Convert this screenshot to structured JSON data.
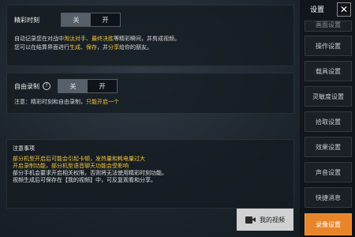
{
  "highlights": {
    "panel1_row1": [
      {
        "t": "自动记录您在对战中",
        "h": false
      },
      {
        "t": "淘汰对手、最终决胜",
        "h": true
      },
      {
        "t": "等精彩瞬间，并剪成视频。",
        "h": false
      }
    ],
    "panel1_row2": [
      {
        "t": "您可以在结算界面进行",
        "h": false
      },
      {
        "t": "生成、保存",
        "h": true
      },
      {
        "t": "，并",
        "h": false
      },
      {
        "t": "分享",
        "h": true
      },
      {
        "t": "给你的朋友。",
        "h": false
      }
    ],
    "panel2_note": [
      {
        "t": "注意：精彩时刻和自由录制，",
        "h": false
      },
      {
        "t": "只能开启一个",
        "h": true
      }
    ]
  },
  "highlights_section": {
    "label": "精彩时刻",
    "toggle_off": "关",
    "toggle_on": "开"
  },
  "free_record_section": {
    "label": "自由录制",
    "help": "?",
    "toggle_off": "关",
    "toggle_on": "开"
  },
  "notice": {
    "title": "注意事项",
    "lines": [
      {
        "text": "部分机型开启后可能会引起卡顿，发热量和耗电量过大",
        "color": "yellow"
      },
      {
        "text": "开启录制功能，部分机型语音聊天功能会受影响",
        "color": "yellow"
      },
      {
        "text": "部分手机会要求开启相关权限，否则将无法使用精彩时刻功能。",
        "color": "white"
      },
      {
        "text": "视频生成后可保存在【我的视频】中，可反复观看和分享。",
        "color": "white"
      }
    ]
  },
  "my_video_button": {
    "label": "我的视频",
    "icon": "video-camera-icon"
  },
  "sidebar": {
    "title": "设置",
    "close": "✕",
    "items": [
      {
        "label": "画面设置",
        "state": "cut"
      },
      {
        "label": "操作设置",
        "state": "normal"
      },
      {
        "label": "载具设置",
        "state": "normal"
      },
      {
        "label": "灵敏度设置",
        "state": "normal"
      },
      {
        "label": "拾取设置",
        "state": "normal"
      },
      {
        "label": "效果设置",
        "state": "normal"
      },
      {
        "label": "声音设置",
        "state": "normal"
      },
      {
        "label": "快捷消息",
        "state": "normal"
      },
      {
        "label": "录像设置",
        "state": "active"
      }
    ]
  },
  "colors": {
    "accent": "#e8852a",
    "highlight_text": "#f4c43a"
  }
}
